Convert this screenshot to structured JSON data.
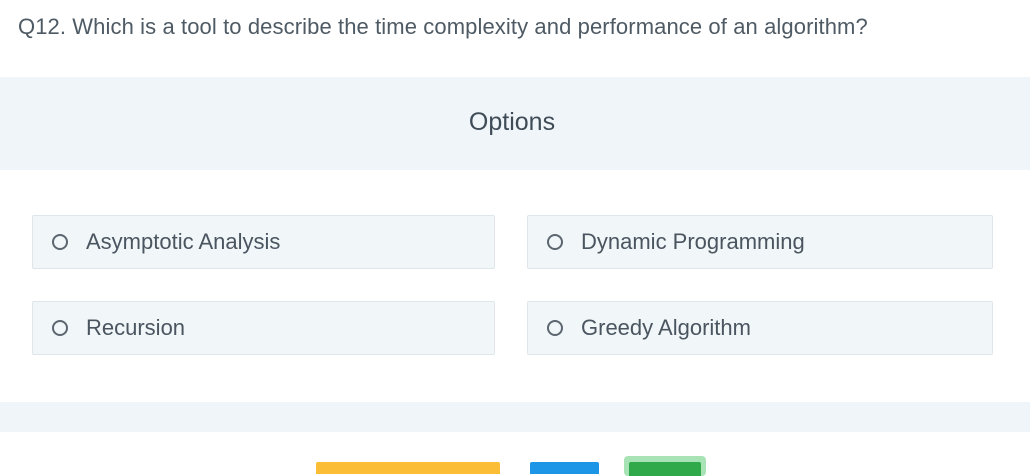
{
  "question": {
    "text": "Q12.  Which is a tool to describe the time complexity and performance of an algorithm?"
  },
  "options_header": "Options",
  "options": [
    {
      "label": "Asymptotic Analysis",
      "selected": false
    },
    {
      "label": "Dynamic Programming",
      "selected": false
    },
    {
      "label": "Recursion",
      "selected": false
    },
    {
      "label": "Greedy Algorithm",
      "selected": false
    }
  ],
  "colors": {
    "band": "#eff5f8",
    "option_bg": "#f1f6f8",
    "button_yellow": "#fcbd36",
    "button_blue": "#1e96e8",
    "button_green": "#2fa94a"
  }
}
